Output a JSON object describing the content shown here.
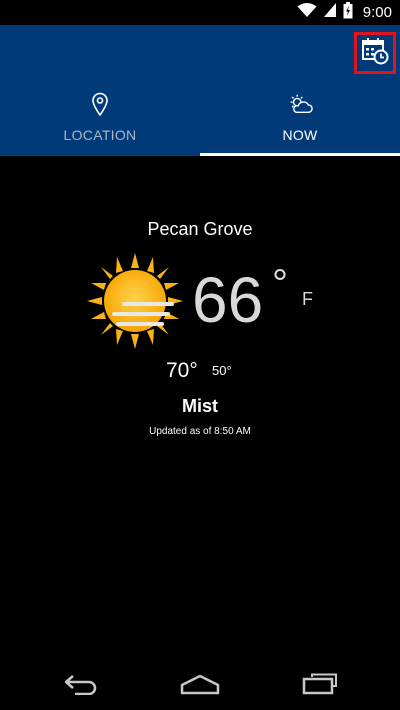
{
  "status_bar": {
    "time": "9:00",
    "icons": [
      "wifi-icon",
      "cell-signal-icon",
      "battery-icon"
    ]
  },
  "header": {
    "calendar_icon": "calendar-clock-icon",
    "tabs": [
      {
        "label": "LOCATION",
        "icon": "location-pin-icon",
        "active": false
      },
      {
        "label": "NOW",
        "icon": "partly-cloudy-icon",
        "active": true
      }
    ],
    "colors": {
      "background": "#003a78",
      "highlight": "#e0141c"
    }
  },
  "weather": {
    "location": "Pecan Grove",
    "icon": "sun-mist-icon",
    "temperature": "66",
    "degree_symbol": "°",
    "unit": "F",
    "high": "70°",
    "low": "50°",
    "condition": "Mist",
    "updated": "Updated as of 8:50 AM"
  },
  "nav_bar": {
    "buttons": [
      "back-icon",
      "home-icon",
      "recents-icon"
    ]
  }
}
